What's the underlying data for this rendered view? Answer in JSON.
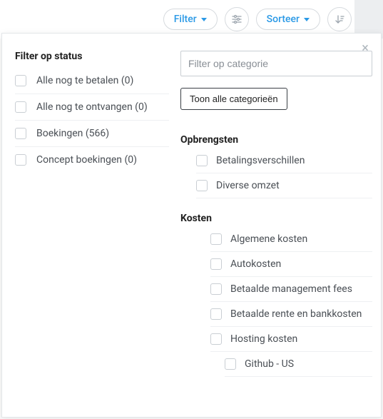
{
  "topbar": {
    "filter_label": "Filter",
    "sort_label": "Sorteer"
  },
  "panel": {
    "left": {
      "heading": "Filter op status",
      "statuses": [
        {
          "label": "Alle nog te betalen (0)"
        },
        {
          "label": "Alle nog te ontvangen (0)"
        },
        {
          "label": "Boekingen (566)"
        },
        {
          "label": "Concept boekingen (0)"
        }
      ]
    },
    "right": {
      "category_placeholder": "Filter op categorie",
      "show_all_label": "Toon alle categorieën",
      "groups": {
        "revenue": {
          "title": "Opbrengsten",
          "items": [
            {
              "label": "Betalingsverschillen"
            },
            {
              "label": "Diverse omzet"
            }
          ]
        },
        "costs": {
          "title": "Kosten",
          "items": [
            {
              "label": "Algemene kosten",
              "level": 2
            },
            {
              "label": "Autokosten",
              "level": 2
            },
            {
              "label": "Betaalde management fees",
              "level": 2
            },
            {
              "label": "Betaalde rente en bankkosten",
              "level": 2
            },
            {
              "label": "Hosting kosten",
              "level": 2
            },
            {
              "label": "Github - US",
              "level": 3
            }
          ]
        }
      }
    }
  }
}
